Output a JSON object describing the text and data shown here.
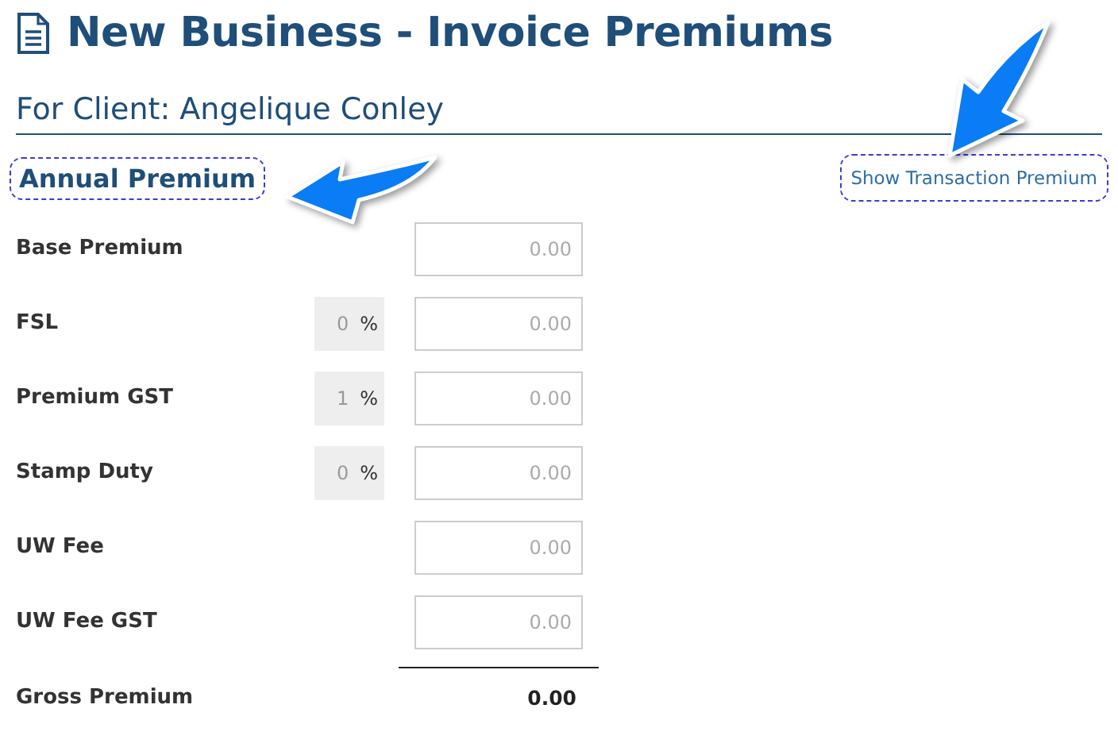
{
  "page": {
    "title": "New Business - Invoice Premiums",
    "client": "For Client: Angelique Conley"
  },
  "section": {
    "title": "Annual Premium",
    "toggle_link": "Show Transaction Premium"
  },
  "rows": [
    {
      "kind": "amount",
      "label": "Base Premium",
      "placeholder": "0.00"
    },
    {
      "kind": "rate",
      "label": "FSL",
      "rate": "0",
      "unit": "%",
      "placeholder": "0.00"
    },
    {
      "kind": "rate",
      "label": "Premium GST",
      "rate": "1",
      "unit": "%",
      "placeholder": "0.00"
    },
    {
      "kind": "rate",
      "label": "Stamp Duty",
      "rate": "0",
      "unit": "%",
      "placeholder": "0.00"
    },
    {
      "kind": "amount",
      "label": "UW Fee",
      "placeholder": "0.00"
    },
    {
      "kind": "amount",
      "label": "UW Fee GST",
      "placeholder": "0.00"
    }
  ],
  "total": {
    "label": "Gross Premium",
    "value": "0.00"
  }
}
